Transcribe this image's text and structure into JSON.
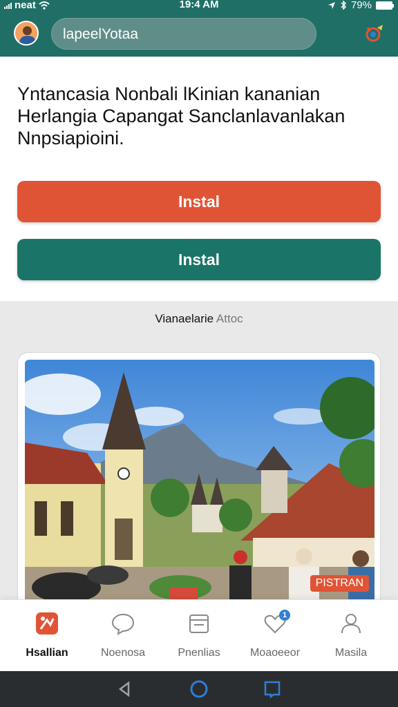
{
  "status_bar": {
    "carrier": "neat",
    "time": "19:4 AM",
    "battery": "79%"
  },
  "app_bar": {
    "search_text": "lapeelYotaa"
  },
  "headline": "Yntancasia Nonbali lKinian kananian Herlangia Capangat Sanclanlavanlakan Nnpsiapioini.",
  "buttons": {
    "primary_label": "Instal",
    "secondary_label": "Instal"
  },
  "section": {
    "title_strong": "Vianaelarie",
    "title_soft": "Attoc"
  },
  "photo": {
    "badge": "PISTRAN"
  },
  "bottom_nav": {
    "items": [
      {
        "label": "Hsallian",
        "icon": "app-logo-icon"
      },
      {
        "label": "Noenosa",
        "icon": "chat-bubble-icon"
      },
      {
        "label": "Pnenlias",
        "icon": "calendar-icon"
      },
      {
        "label": "Moaoeeor",
        "icon": "heart-icon",
        "badge": "1"
      },
      {
        "label": "Masila",
        "icon": "profile-icon"
      }
    ]
  },
  "colors": {
    "app_bar": "#1f6f67",
    "primary_button": "#e05436",
    "secondary_button": "#1b7468"
  }
}
